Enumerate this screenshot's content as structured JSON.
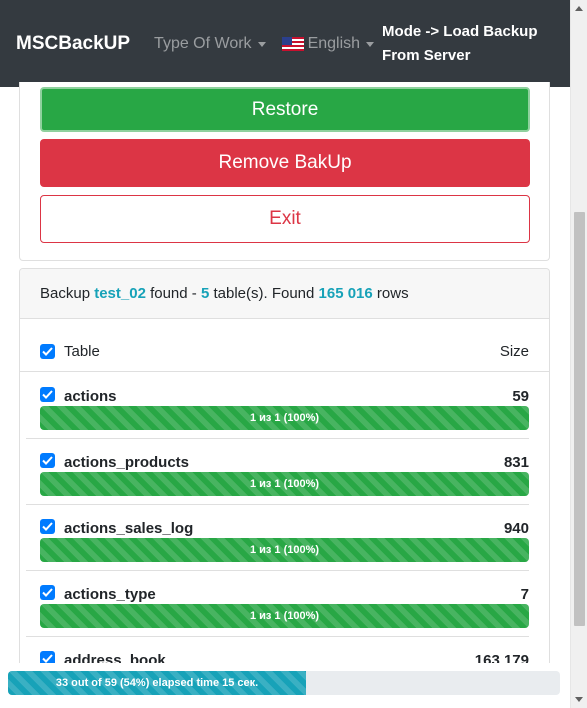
{
  "navbar": {
    "brand": "MSCBackUP",
    "type_of_work": "Type Of Work",
    "language": "English",
    "mode_line1": "Mode -> Load Backup",
    "mode_line2": "From Server"
  },
  "actions": {
    "restore": "Restore",
    "remove": "Remove BakUp",
    "exit": "Exit"
  },
  "summary": {
    "prefix": "Backup ",
    "backup_name": "test_02",
    "found_text": " found - ",
    "table_count": "5",
    "tables_text": " table(s). Found ",
    "row_count": "165 016",
    "rows_text": " rows"
  },
  "table": {
    "header_label": "Table",
    "header_size": "Size",
    "rows": [
      {
        "name": "actions",
        "size": "59",
        "progress_text": "1 из 1 (100%)",
        "progress": 100
      },
      {
        "name": "actions_products",
        "size": "831",
        "progress_text": "1 из 1 (100%)",
        "progress": 100
      },
      {
        "name": "actions_sales_log",
        "size": "940",
        "progress_text": "1 из 1 (100%)",
        "progress": 100
      },
      {
        "name": "actions_type",
        "size": "7",
        "progress_text": "1 из 1 (100%)",
        "progress": 100
      },
      {
        "name": "address_book",
        "size": "163 179",
        "progress_text": "",
        "progress": 0
      }
    ]
  },
  "global_progress": {
    "text": "33 out of 59 (54%) elapsed time 15 сек.",
    "percent": 54
  },
  "colors": {
    "navbar": "#343a40",
    "success": "#28a745",
    "danger": "#dc3545",
    "info": "#17a2b8",
    "checkbox": "#007bff"
  }
}
